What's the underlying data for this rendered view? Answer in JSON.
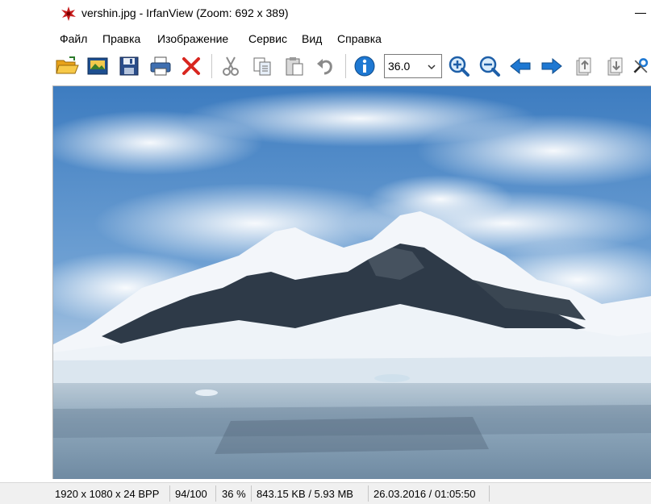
{
  "window": {
    "title": "vershin.jpg - IrfanView (Zoom: 692 x 389)"
  },
  "menu": [
    "Файл",
    "Правка",
    "Изображение",
    "Сервис",
    "Вид",
    "Справка"
  ],
  "toolbar": {
    "zoom_value": "36.0",
    "buttons": [
      {
        "name": "open-folder-icon"
      },
      {
        "name": "slideshow-icon"
      },
      {
        "name": "save-icon"
      },
      {
        "name": "print-icon"
      },
      {
        "name": "delete-icon"
      },
      {
        "name": "cut-icon"
      },
      {
        "name": "copy-icon"
      },
      {
        "name": "paste-icon"
      },
      {
        "name": "undo-icon"
      },
      {
        "name": "info-icon"
      },
      {
        "name": "zoom-in-icon"
      },
      {
        "name": "zoom-out-icon"
      },
      {
        "name": "previous-arrow-icon"
      },
      {
        "name": "next-arrow-icon"
      },
      {
        "name": "first-page-icon"
      },
      {
        "name": "last-page-icon"
      },
      {
        "name": "tools-icon"
      }
    ]
  },
  "status": {
    "dimensions": "1920 x 1080 x 24 BPP",
    "index": "94/100",
    "zoom": "36 %",
    "size": "843.15 KB / 5.93 MB",
    "datetime": "26.03.2016 / 01:05:50"
  },
  "colors": {
    "sky_top": "#2f6fb6",
    "mountain_dark": "#2e3a48",
    "water": "#9fb6c9",
    "accent_red": "#d8261f",
    "accent_blue": "#1e78d2"
  }
}
